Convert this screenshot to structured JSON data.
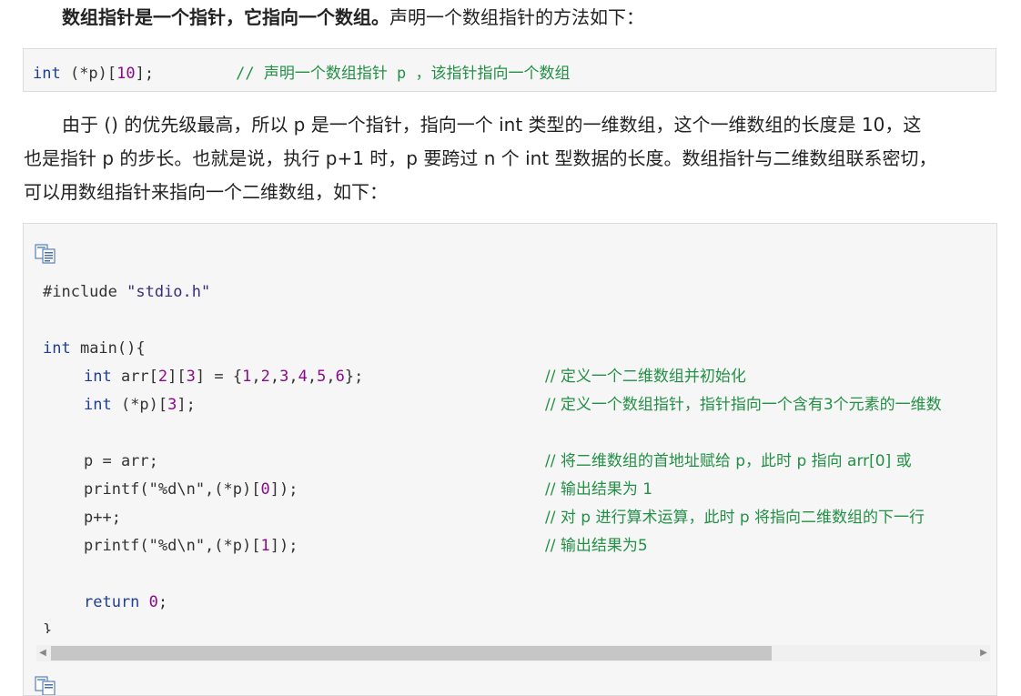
{
  "para1": {
    "bold": "数组指针是一个指针，它指向一个数组。",
    "rest": "声明一个数组指针的方法如下："
  },
  "inline_code": {
    "kw": "int",
    "decl_a": " (*p)[",
    "num": "10",
    "decl_b": "];",
    "comment": "// 声明一个数组指针 p ，该指针指向一个数组"
  },
  "para2": {
    "line1": "由于 () 的优先级最高，所以 p 是一个指针，指向一个 int 类型的一维数组，这个一维数组的长度是 10，这",
    "line2": "也是指针 p 的步长。也就是说，执行 p+1 时，p 要跨过 n 个 int 型数据的长度。数组指针与二维数组联系密切，",
    "line3": "可以用数组指针来指向一个二维数组，如下："
  },
  "code": {
    "include_kw": "#include",
    "include_str": " \"stdio.h\"",
    "main_kw": "int",
    "main_rest": " main(){",
    "l1_kw": "int",
    "l1_a": " arr[",
    "l1_n1": "2",
    "l1_b": "][",
    "l1_n2": "3",
    "l1_c": "] = {",
    "l1_v1": "1",
    "l1_v2": "2",
    "l1_v3": "3",
    "l1_v4": "4",
    "l1_v5": "5",
    "l1_v6": "6",
    "l1_d": "};",
    "l1_cm": "// 定义一个二维数组并初始化",
    "l2_kw": "int",
    "l2_a": " (*p)[",
    "l2_n": "3",
    "l2_b": "];",
    "l2_cm": "// 定义一个数组指针，指针指向一个含有3个元素的一维数",
    "l3_code": "p = arr;",
    "l3_cm": "// 将二维数组的首地址赋给 p，此时 p 指向 arr[0] 或",
    "l4_a": "printf(\"%d\\n\",(*p)[",
    "l4_n": "0",
    "l4_b": "]);",
    "l4_cm": "// 输出结果为 1",
    "l5_code": "p++;",
    "l5_cm": "// 对 p 进行算术运算，此时 p 将指向二维数组的下一行",
    "l6_a": "printf(\"%d\\n\",(*p)[",
    "l6_n": "1",
    "l6_b": "]);",
    "l6_cm": "// 输出结果为5",
    "ret_kw": "return",
    "ret_n": " 0",
    "ret_end": ";",
    "close": "}"
  },
  "icons": {
    "copy": "copy-code-icon",
    "scroll_left": "arrow-left-icon",
    "scroll_right": "arrow-right-icon"
  },
  "scrollbar": {
    "thumb_fraction": 0.78
  }
}
